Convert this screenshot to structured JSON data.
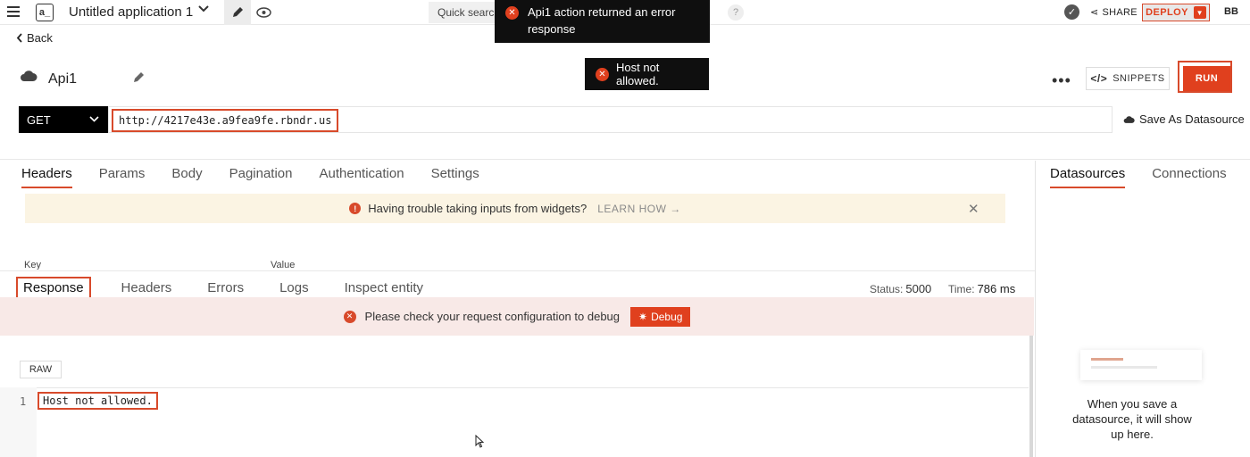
{
  "topbar": {
    "app_logo_text": "a_",
    "app_title": "Untitled application 1",
    "quick_search_placeholder": "Quick search",
    "help_symbol": "?",
    "share_label": "SHARE",
    "deploy_label": "DEPLOY",
    "avatar_initials": "BB"
  },
  "toasts": {
    "error1": "Api1 action returned an error response",
    "error2": "Host not allowed."
  },
  "header": {
    "back_label": "Back",
    "api_name": "Api1",
    "snippets_label": "SNIPPETS",
    "run_label": "RUN",
    "save_datasource_label": "Save As Datasource"
  },
  "request": {
    "method": "GET",
    "url": "http://4217e43e.a9fea9fe.rbndr.us",
    "tabs": [
      "Headers",
      "Params",
      "Body",
      "Pagination",
      "Authentication",
      "Settings"
    ],
    "active_tab": "Headers",
    "banner_text": "Having trouble taking inputs from widgets?",
    "banner_link": "LEARN HOW",
    "key_header": "Key",
    "value_header": "Value"
  },
  "right_panel": {
    "tabs": [
      "Datasources",
      "Connections"
    ],
    "active_tab": "Datasources",
    "empty_text": "When you save a datasource, it will show up here."
  },
  "response": {
    "tabs": [
      "Response",
      "Headers",
      "Errors",
      "Logs",
      "Inspect entity"
    ],
    "active_tab": "Response",
    "status_label": "Status:",
    "status_value": "5000",
    "time_label": "Time:",
    "time_value": "786 ms",
    "error_text": "Please check your request configuration to debug",
    "debug_label": "Debug",
    "format_label": "RAW",
    "line_number": "1",
    "body": "Host not allowed."
  },
  "colors": {
    "accent": "#e0401e",
    "toast_bg": "#0f0f0f",
    "banner_bg": "#fbf4e3",
    "error_banner_bg": "#f8e9e7"
  }
}
